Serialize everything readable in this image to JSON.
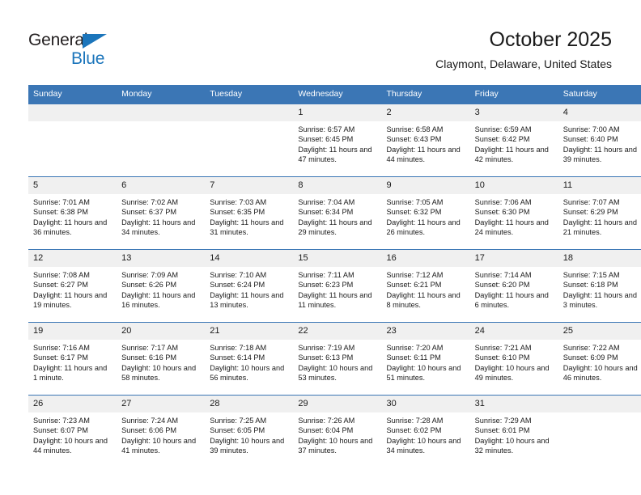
{
  "brand": {
    "name_part1": "General",
    "name_part2": "Blue",
    "triangle_color": "#1b75bb",
    "text_color": "#231f20"
  },
  "header": {
    "title": "October 2025",
    "subtitle": "Claymont, Delaware, United States"
  },
  "theme": {
    "header_bg": "#3b76b5",
    "header_text": "#ffffff",
    "daynum_bg": "#f0f0f0",
    "grid_line": "#3b76b5"
  },
  "weekdays": [
    "Sunday",
    "Monday",
    "Tuesday",
    "Wednesday",
    "Thursday",
    "Friday",
    "Saturday"
  ],
  "labels": {
    "sunrise_prefix": "Sunrise: ",
    "sunset_prefix": "Sunset: ",
    "daylight_prefix": "Daylight: "
  },
  "weeks": [
    [
      {
        "day": "",
        "sunrise": "",
        "sunset": "",
        "daylight": ""
      },
      {
        "day": "",
        "sunrise": "",
        "sunset": "",
        "daylight": ""
      },
      {
        "day": "",
        "sunrise": "",
        "sunset": "",
        "daylight": ""
      },
      {
        "day": "1",
        "sunrise": "Sunrise: 6:57 AM",
        "sunset": "Sunset: 6:45 PM",
        "daylight": "Daylight: 11 hours and 47 minutes."
      },
      {
        "day": "2",
        "sunrise": "Sunrise: 6:58 AM",
        "sunset": "Sunset: 6:43 PM",
        "daylight": "Daylight: 11 hours and 44 minutes."
      },
      {
        "day": "3",
        "sunrise": "Sunrise: 6:59 AM",
        "sunset": "Sunset: 6:42 PM",
        "daylight": "Daylight: 11 hours and 42 minutes."
      },
      {
        "day": "4",
        "sunrise": "Sunrise: 7:00 AM",
        "sunset": "Sunset: 6:40 PM",
        "daylight": "Daylight: 11 hours and 39 minutes."
      }
    ],
    [
      {
        "day": "5",
        "sunrise": "Sunrise: 7:01 AM",
        "sunset": "Sunset: 6:38 PM",
        "daylight": "Daylight: 11 hours and 36 minutes."
      },
      {
        "day": "6",
        "sunrise": "Sunrise: 7:02 AM",
        "sunset": "Sunset: 6:37 PM",
        "daylight": "Daylight: 11 hours and 34 minutes."
      },
      {
        "day": "7",
        "sunrise": "Sunrise: 7:03 AM",
        "sunset": "Sunset: 6:35 PM",
        "daylight": "Daylight: 11 hours and 31 minutes."
      },
      {
        "day": "8",
        "sunrise": "Sunrise: 7:04 AM",
        "sunset": "Sunset: 6:34 PM",
        "daylight": "Daylight: 11 hours and 29 minutes."
      },
      {
        "day": "9",
        "sunrise": "Sunrise: 7:05 AM",
        "sunset": "Sunset: 6:32 PM",
        "daylight": "Daylight: 11 hours and 26 minutes."
      },
      {
        "day": "10",
        "sunrise": "Sunrise: 7:06 AM",
        "sunset": "Sunset: 6:30 PM",
        "daylight": "Daylight: 11 hours and 24 minutes."
      },
      {
        "day": "11",
        "sunrise": "Sunrise: 7:07 AM",
        "sunset": "Sunset: 6:29 PM",
        "daylight": "Daylight: 11 hours and 21 minutes."
      }
    ],
    [
      {
        "day": "12",
        "sunrise": "Sunrise: 7:08 AM",
        "sunset": "Sunset: 6:27 PM",
        "daylight": "Daylight: 11 hours and 19 minutes."
      },
      {
        "day": "13",
        "sunrise": "Sunrise: 7:09 AM",
        "sunset": "Sunset: 6:26 PM",
        "daylight": "Daylight: 11 hours and 16 minutes."
      },
      {
        "day": "14",
        "sunrise": "Sunrise: 7:10 AM",
        "sunset": "Sunset: 6:24 PM",
        "daylight": "Daylight: 11 hours and 13 minutes."
      },
      {
        "day": "15",
        "sunrise": "Sunrise: 7:11 AM",
        "sunset": "Sunset: 6:23 PM",
        "daylight": "Daylight: 11 hours and 11 minutes."
      },
      {
        "day": "16",
        "sunrise": "Sunrise: 7:12 AM",
        "sunset": "Sunset: 6:21 PM",
        "daylight": "Daylight: 11 hours and 8 minutes."
      },
      {
        "day": "17",
        "sunrise": "Sunrise: 7:14 AM",
        "sunset": "Sunset: 6:20 PM",
        "daylight": "Daylight: 11 hours and 6 minutes."
      },
      {
        "day": "18",
        "sunrise": "Sunrise: 7:15 AM",
        "sunset": "Sunset: 6:18 PM",
        "daylight": "Daylight: 11 hours and 3 minutes."
      }
    ],
    [
      {
        "day": "19",
        "sunrise": "Sunrise: 7:16 AM",
        "sunset": "Sunset: 6:17 PM",
        "daylight": "Daylight: 11 hours and 1 minute."
      },
      {
        "day": "20",
        "sunrise": "Sunrise: 7:17 AM",
        "sunset": "Sunset: 6:16 PM",
        "daylight": "Daylight: 10 hours and 58 minutes."
      },
      {
        "day": "21",
        "sunrise": "Sunrise: 7:18 AM",
        "sunset": "Sunset: 6:14 PM",
        "daylight": "Daylight: 10 hours and 56 minutes."
      },
      {
        "day": "22",
        "sunrise": "Sunrise: 7:19 AM",
        "sunset": "Sunset: 6:13 PM",
        "daylight": "Daylight: 10 hours and 53 minutes."
      },
      {
        "day": "23",
        "sunrise": "Sunrise: 7:20 AM",
        "sunset": "Sunset: 6:11 PM",
        "daylight": "Daylight: 10 hours and 51 minutes."
      },
      {
        "day": "24",
        "sunrise": "Sunrise: 7:21 AM",
        "sunset": "Sunset: 6:10 PM",
        "daylight": "Daylight: 10 hours and 49 minutes."
      },
      {
        "day": "25",
        "sunrise": "Sunrise: 7:22 AM",
        "sunset": "Sunset: 6:09 PM",
        "daylight": "Daylight: 10 hours and 46 minutes."
      }
    ],
    [
      {
        "day": "26",
        "sunrise": "Sunrise: 7:23 AM",
        "sunset": "Sunset: 6:07 PM",
        "daylight": "Daylight: 10 hours and 44 minutes."
      },
      {
        "day": "27",
        "sunrise": "Sunrise: 7:24 AM",
        "sunset": "Sunset: 6:06 PM",
        "daylight": "Daylight: 10 hours and 41 minutes."
      },
      {
        "day": "28",
        "sunrise": "Sunrise: 7:25 AM",
        "sunset": "Sunset: 6:05 PM",
        "daylight": "Daylight: 10 hours and 39 minutes."
      },
      {
        "day": "29",
        "sunrise": "Sunrise: 7:26 AM",
        "sunset": "Sunset: 6:04 PM",
        "daylight": "Daylight: 10 hours and 37 minutes."
      },
      {
        "day": "30",
        "sunrise": "Sunrise: 7:28 AM",
        "sunset": "Sunset: 6:02 PM",
        "daylight": "Daylight: 10 hours and 34 minutes."
      },
      {
        "day": "31",
        "sunrise": "Sunrise: 7:29 AM",
        "sunset": "Sunset: 6:01 PM",
        "daylight": "Daylight: 10 hours and 32 minutes."
      },
      {
        "day": "",
        "sunrise": "",
        "sunset": "",
        "daylight": ""
      }
    ]
  ]
}
